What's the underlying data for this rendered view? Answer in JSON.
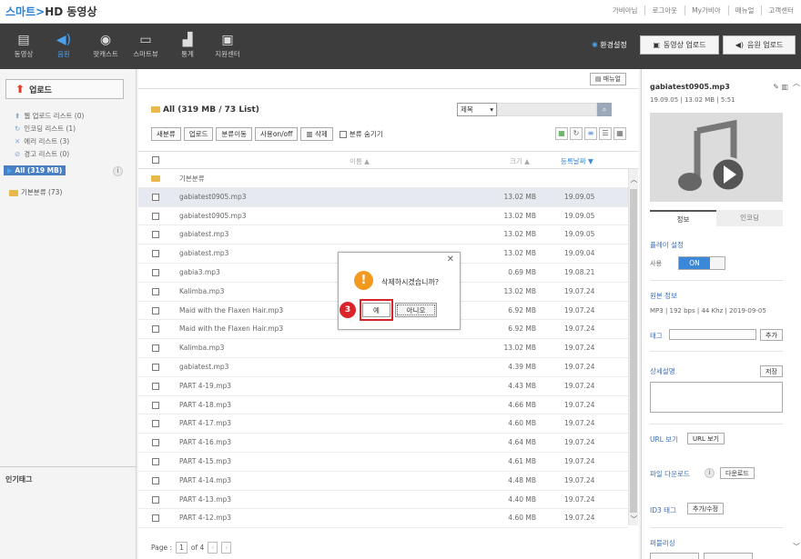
{
  "header": {
    "logo_smart": "스마트",
    "logo_rest": "HD 동영상",
    "links": [
      "가비아님",
      "로그아웃",
      "My가비아",
      "매뉴얼",
      "고객센터"
    ]
  },
  "nav": {
    "items": [
      {
        "label": "동영상",
        "icon": "film-icon"
      },
      {
        "label": "음원",
        "icon": "speaker-icon"
      },
      {
        "label": "팟캐스트",
        "icon": "broadcast-icon"
      },
      {
        "label": "스마트뷰",
        "icon": "monitor-icon"
      },
      {
        "label": "통계",
        "icon": "chart-icon"
      },
      {
        "label": "지원센터",
        "icon": "support-icon"
      }
    ],
    "env_settings": "환경설정",
    "video_upload": "동영상 업로드",
    "audio_upload": "음원 업로드"
  },
  "sidebar": {
    "upload_label": "업로드",
    "lists": [
      {
        "label": "웹 업로드 리스트",
        "count": "(0)"
      },
      {
        "label": "인코딩 리스트",
        "count": "(1)"
      },
      {
        "label": "에러 리스트",
        "count": "(3)"
      },
      {
        "label": "경고 리스트",
        "count": "(0)"
      }
    ],
    "all_label": "All (319 MB)",
    "folder_label": "기본분류 (73)",
    "hot_tags": "인기태그"
  },
  "main": {
    "manual_btn": "매뉴얼",
    "title": "All (319 MB / 73 List)",
    "sort_value": "제목",
    "toolbar": {
      "new_category": "새분류",
      "upload": "업로드",
      "move_category": "분류이동",
      "use_onoff": "사용on/off",
      "delete": "삭제",
      "hide_category": "분류 숨기기"
    },
    "columns": {
      "name": "이름 ▲",
      "size": "크기 ▲",
      "date": "등록날짜 ▼"
    },
    "folder_row": "기본분류",
    "rows": [
      {
        "name": "gabiatest0905.mp3",
        "size": "13.02 MB",
        "date": "19.09.05"
      },
      {
        "name": "gabiatest0905.mp3",
        "size": "13.02 MB",
        "date": "19.09.05"
      },
      {
        "name": "gabiatest.mp3",
        "size": "13.02 MB",
        "date": "19.09.05"
      },
      {
        "name": "gabiatest.mp3",
        "size": "13.02 MB",
        "date": "19.09.04"
      },
      {
        "name": "gabia3.mp3",
        "size": "0.69 MB",
        "date": "19.08.21"
      },
      {
        "name": "Kalimba.mp3",
        "size": "13.02 MB",
        "date": "19.07.24"
      },
      {
        "name": "Maid with the Flaxen Hair.mp3",
        "size": "6.92 MB",
        "date": "19.07.24"
      },
      {
        "name": "Maid with the Flaxen Hair.mp3",
        "size": "6.92 MB",
        "date": "19.07.24"
      },
      {
        "name": "Kalimba.mp3",
        "size": "13.02 MB",
        "date": "19.07.24"
      },
      {
        "name": "gabiatest.mp3",
        "size": "4.39 MB",
        "date": "19.07.24"
      },
      {
        "name": "PART 4-19.mp3",
        "size": "4.43 MB",
        "date": "19.07.24"
      },
      {
        "name": "PART 4-18.mp3",
        "size": "4.66 MB",
        "date": "19.07.24"
      },
      {
        "name": "PART 4-17.mp3",
        "size": "4.60 MB",
        "date": "19.07.24"
      },
      {
        "name": "PART 4-16.mp3",
        "size": "4.64 MB",
        "date": "19.07.24"
      },
      {
        "name": "PART 4-15.mp3",
        "size": "4.61 MB",
        "date": "19.07.24"
      },
      {
        "name": "PART 4-14.mp3",
        "size": "4.48 MB",
        "date": "19.07.24"
      },
      {
        "name": "PART 4-13.mp3",
        "size": "4.40 MB",
        "date": "19.07.24"
      },
      {
        "name": "PART 4-12.mp3",
        "size": "4.60 MB",
        "date": "19.07.24"
      }
    ],
    "pager": {
      "label": "Page :",
      "current": "1",
      "total": "of 4"
    }
  },
  "detail": {
    "filename": "gabiatest0905.mp3",
    "meta": "19.09.05 | 13.02 MB | 5:51",
    "tab_info": "정보",
    "tab_encoding": "인코딩",
    "play_setting": "플레이 설정",
    "use_label": "사용",
    "toggle_on": "ON",
    "file_info_title": "원본 정보",
    "file_info": "MP3 | 192 bps | 44 Khz | 2019-09-05",
    "tag_label": "태그",
    "tag_add": "추가",
    "desc_label": "상세설명",
    "desc_save": "저장",
    "url_label": "URL 보기",
    "url_btn": "URL 보기",
    "download_label": "파일 다운로드",
    "download_btn": "다운로드",
    "id3_label": "ID3 태그",
    "id3_btn": "추가/수정",
    "publish_label": "퍼블리싱"
  },
  "dialog": {
    "message": "삭제하시겠습니까?",
    "yes": "예",
    "no": "아니오",
    "step": "3",
    "warn_icon": "!"
  },
  "colors": {
    "accent": "#3b87d8",
    "nav_bg": "#3d3d3d",
    "highlight": "#d9252a",
    "warning": "#f39a1e"
  }
}
